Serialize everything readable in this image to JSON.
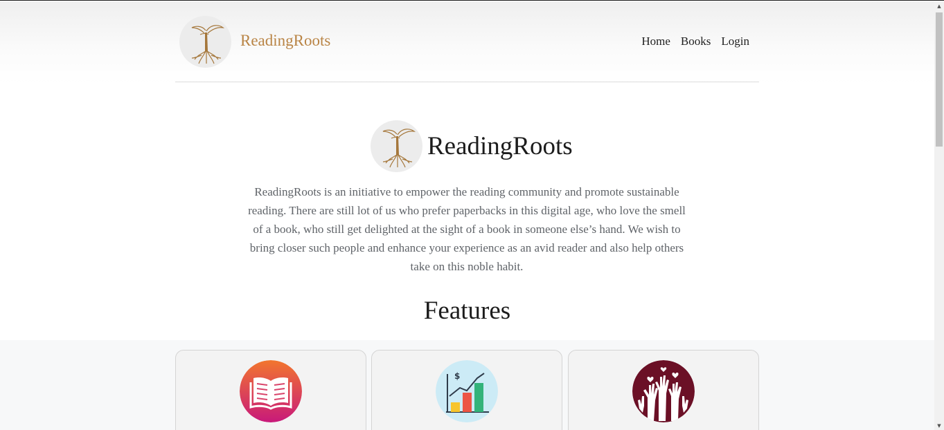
{
  "nav": {
    "brand": "ReadingRoots",
    "logo_icon": "tree-roots-icon",
    "links": [
      "Home",
      "Books",
      "Login"
    ]
  },
  "hero": {
    "title": "ReadingRoots",
    "description": "ReadingRoots is an initiative to empower the reading community and promote sustainable reading. There are still lot of us who prefer paperbacks in this digital age, who love the smell of a book, who still get delighted at the sight of a book in someone else’s hand. We wish to bring closer such people and enhance your experience as an avid reader and also help others take on this noble habit."
  },
  "features": {
    "title": "Features",
    "cards": [
      {
        "icon": "open-book-icon"
      },
      {
        "icon": "growth-chart-icon"
      },
      {
        "icon": "raised-hands-icon"
      }
    ]
  },
  "colors": {
    "brand": "#b98445",
    "text_muted": "#5f6368",
    "card_bg": "#f3f3f3"
  }
}
